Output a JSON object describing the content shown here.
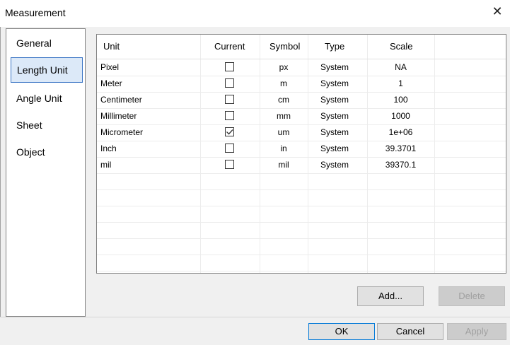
{
  "window": {
    "title": "Measurement",
    "close_label": "✕"
  },
  "sidebar": {
    "items": [
      {
        "label": "General",
        "active": false
      },
      {
        "label": "Length Unit",
        "active": true
      },
      {
        "label": "Angle Unit",
        "active": false
      },
      {
        "label": "Sheet",
        "active": false
      },
      {
        "label": "Object",
        "active": false
      }
    ]
  },
  "table": {
    "columns": [
      "Unit",
      "Current",
      "Symbol",
      "Type",
      "Scale"
    ],
    "rows": [
      {
        "unit": "Pixel",
        "current": false,
        "symbol": "px",
        "type": "System",
        "scale": "NA"
      },
      {
        "unit": "Meter",
        "current": false,
        "symbol": "m",
        "type": "System",
        "scale": "1"
      },
      {
        "unit": "Centimeter",
        "current": false,
        "symbol": "cm",
        "type": "System",
        "scale": "100"
      },
      {
        "unit": "Millimeter",
        "current": false,
        "symbol": "mm",
        "type": "System",
        "scale": "1000"
      },
      {
        "unit": "Micrometer",
        "current": true,
        "symbol": "um",
        "type": "System",
        "scale": "1e+06"
      },
      {
        "unit": "Inch",
        "current": false,
        "symbol": "in",
        "type": "System",
        "scale": "39.3701"
      },
      {
        "unit": "mil",
        "current": false,
        "symbol": "mil",
        "type": "System",
        "scale": "39370.1"
      }
    ]
  },
  "actions": {
    "add_label": "Add...",
    "delete_label": "Delete"
  },
  "footer": {
    "ok_label": "OK",
    "cancel_label": "Cancel",
    "apply_label": "Apply"
  },
  "colors": {
    "accent": "#0078d7",
    "selection": "#dce9f8"
  }
}
